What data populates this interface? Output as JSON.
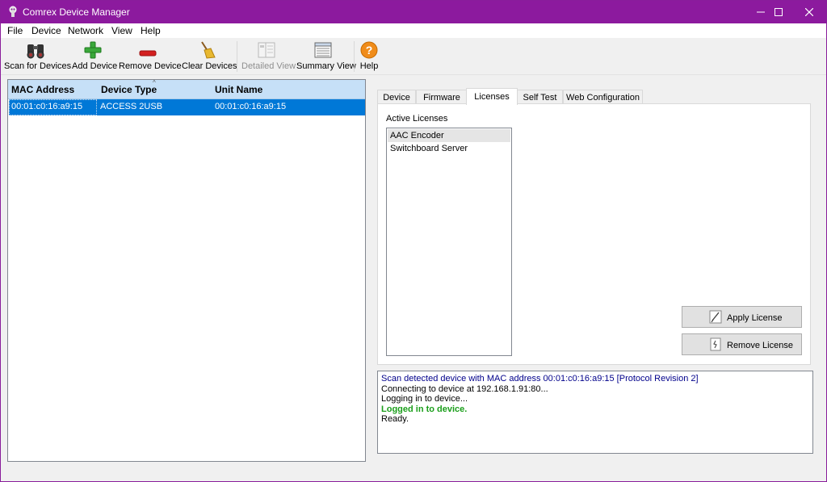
{
  "window": {
    "title": "Comrex Device Manager",
    "accent_color": "#8c1a9e",
    "selection_color": "#0078d7"
  },
  "menu": [
    "File",
    "Device",
    "Network",
    "View",
    "Help"
  ],
  "toolbar": {
    "scan": "Scan for Devices",
    "add": "Add Device",
    "remove": "Remove Device",
    "clear": "Clear Devices",
    "detailed": "Detailed View",
    "summary": "Summary View",
    "help": "Help"
  },
  "device_list": {
    "columns": [
      "MAC Address",
      "Device Type",
      "Unit Name"
    ],
    "rows": [
      {
        "mac": "00:01:c0:16:a9:15",
        "type": "ACCESS 2USB",
        "name": "00:01:c0:16:a9:15"
      }
    ]
  },
  "tabs": [
    "Device",
    "Firmware",
    "Licenses",
    "Self Test",
    "Web Configuration"
  ],
  "active_tab": "Licenses",
  "licenses": {
    "label": "Active Licenses",
    "items": [
      "AAC Encoder",
      "Switchboard Server"
    ],
    "apply_label": "Apply License",
    "remove_label": "Remove License"
  },
  "log": [
    {
      "text": "Scan detected device with MAC address 00:01:c0:16:a9:15 [Protocol Revision 2]",
      "color": "#00008b"
    },
    {
      "text": "Connecting to device at 192.168.1.91:80...",
      "color": "#000000"
    },
    {
      "text": "Logging in to device...",
      "color": "#000000"
    },
    {
      "text": "Logged in to device.",
      "color": "#1a9e1a"
    },
    {
      "text": "Ready.",
      "color": "#000000"
    }
  ]
}
